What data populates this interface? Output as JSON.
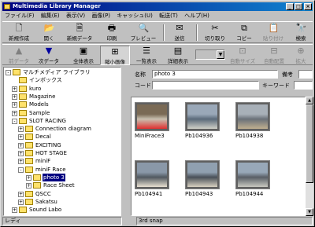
{
  "window": {
    "title": "Multimedia Library Manager"
  },
  "menu": [
    "ファイル(F)",
    "編集(E)",
    "表示(V)",
    "画像(P)",
    "キャッシュ(U)",
    "転送(T)",
    "ヘルプ(H)"
  ],
  "toolbar1": {
    "new_create": "新規作成",
    "open": "開く",
    "new_data": "新規データ",
    "print": "印刷",
    "preview": "プレビュー",
    "send": "送信",
    "cut": "切り取り",
    "copy": "コピー",
    "paste": "貼り付け",
    "search": "検索"
  },
  "toolbar2": {
    "prev_data": "前データ",
    "next_data": "次データ",
    "full_view": "全体表示",
    "thumbnail_view": "縮小画像",
    "list_view": "一覧表示",
    "detail_view": "詳細表示",
    "auto_size": "自動サイズ",
    "auto_layout": "自動配置",
    "zoom": "拡大"
  },
  "tree": [
    {
      "label": "マルチメディア ライブラリ",
      "level": 0,
      "toggle": "-"
    },
    {
      "label": "インボックス",
      "level": 1,
      "toggle": ""
    },
    {
      "label": "kuro",
      "level": 1,
      "toggle": "+"
    },
    {
      "label": "Magazine",
      "level": 1,
      "toggle": "+"
    },
    {
      "label": "Models",
      "level": 1,
      "toggle": "+"
    },
    {
      "label": "Sample",
      "level": 1,
      "toggle": "+"
    },
    {
      "label": "SLOT RACING",
      "level": 1,
      "toggle": "-"
    },
    {
      "label": "Connection diagram",
      "level": 2,
      "toggle": "+"
    },
    {
      "label": "Decal",
      "level": 2,
      "toggle": "+"
    },
    {
      "label": "EXCITING",
      "level": 2,
      "toggle": "+"
    },
    {
      "label": "HOT STAGE",
      "level": 2,
      "toggle": "+"
    },
    {
      "label": "miniF",
      "level": 2,
      "toggle": "+"
    },
    {
      "label": "miniF Race",
      "level": 2,
      "toggle": "-"
    },
    {
      "label": "photo 3",
      "level": 3,
      "toggle": "+",
      "selected": true
    },
    {
      "label": "Race Sheet",
      "level": 3,
      "toggle": "+"
    },
    {
      "label": "QSCC",
      "level": 2,
      "toggle": "+"
    },
    {
      "label": "Sakatsu",
      "level": 2,
      "toggle": "+"
    },
    {
      "label": "Sound Labo",
      "level": 1,
      "toggle": "+"
    }
  ],
  "fields": {
    "name_label": "名称",
    "name_value": "photo 3",
    "remarks_label": "備考",
    "code_label": "コード",
    "keyword_label": "キーワード"
  },
  "thumbnails": [
    {
      "caption": "MiniFrace3"
    },
    {
      "caption": "Pb104936"
    },
    {
      "caption": "Pb104938"
    },
    {
      "caption": "Pb104941"
    },
    {
      "caption": "Pb104943"
    },
    {
      "caption": "Pb104944"
    }
  ],
  "status": {
    "left": "レディ",
    "middle": "3rd snap"
  },
  "colors": {
    "titlebar": "#000080",
    "selection": "#000080",
    "folder": "#ffe26b"
  }
}
